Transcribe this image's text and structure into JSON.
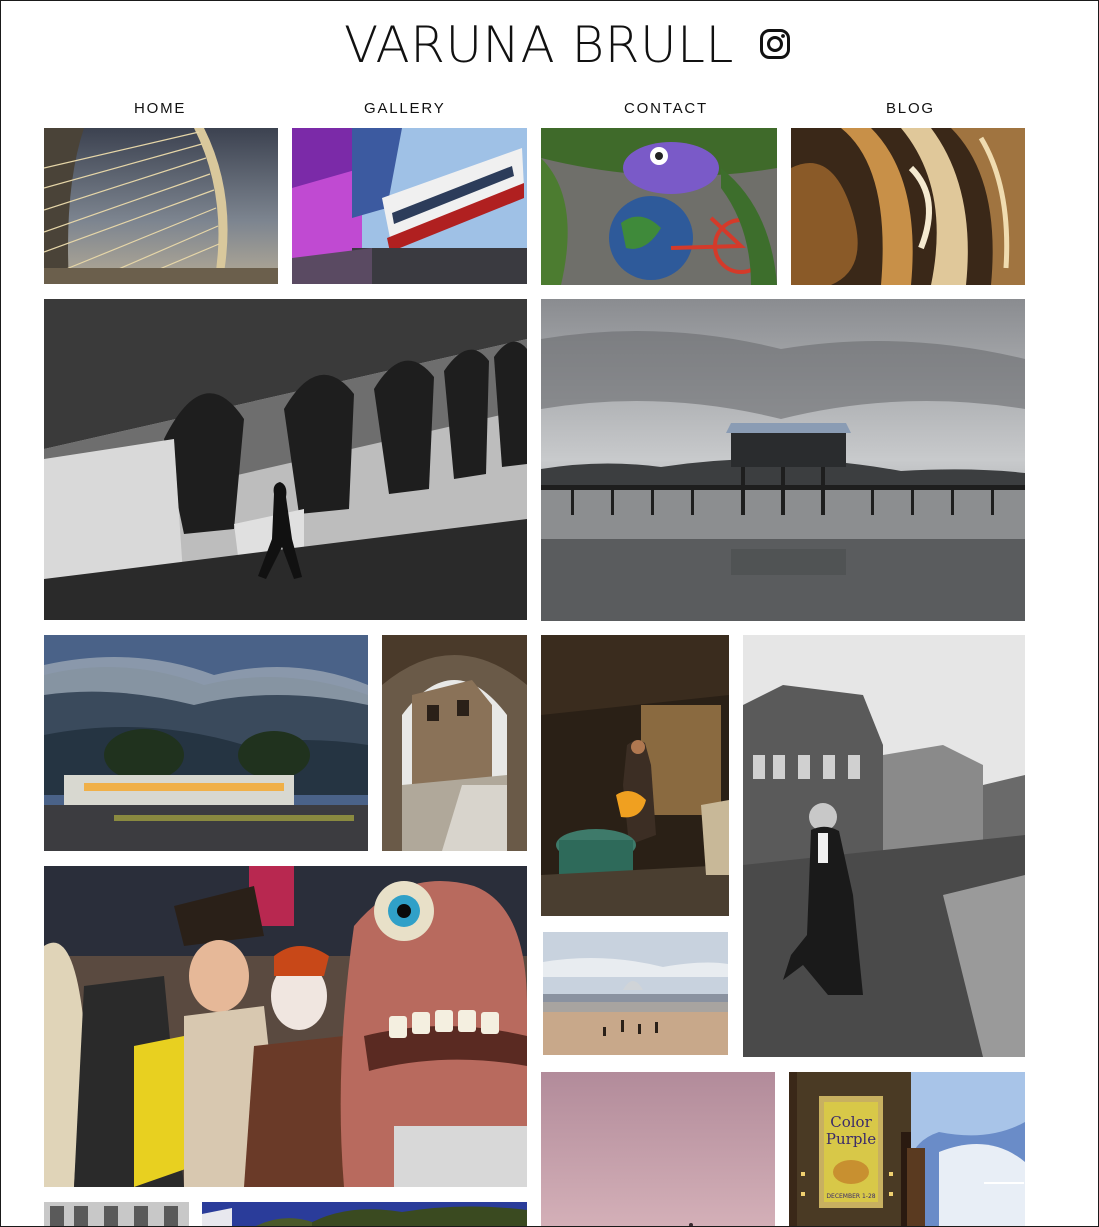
{
  "site": {
    "title": "VARUNA BRULL",
    "social_icon": "instagram-icon"
  },
  "nav": {
    "items": [
      {
        "label": "HOME"
      },
      {
        "label": "GALLERY"
      },
      {
        "label": "CONTACT"
      },
      {
        "label": "BLOG"
      }
    ]
  },
  "gallery": {
    "photos": [
      {
        "subject": "cable-stayed bridge"
      },
      {
        "subject": "monorail train"
      },
      {
        "subject": "fish mural with bicycle"
      },
      {
        "subject": "metallic abstract architecture"
      },
      {
        "subject": "man walking under arches (black and white)"
      },
      {
        "subject": "pier house over water"
      },
      {
        "subject": "misty mountains at dusk"
      },
      {
        "subject": "stone archway alley"
      },
      {
        "subject": "man working in dim workshop"
      },
      {
        "subject": "man walking on rainy street (black and white)"
      },
      {
        "subject": "carnival crowd with giant puppet"
      },
      {
        "subject": "beach with people"
      },
      {
        "subject": "pink sky"
      },
      {
        "subject": "theater marquee"
      },
      {
        "subject": "building facade"
      },
      {
        "subject": "blue sky with trees"
      }
    ],
    "marquee_text": [
      "Color",
      "Purple",
      "DECEMBER 1-28"
    ]
  }
}
